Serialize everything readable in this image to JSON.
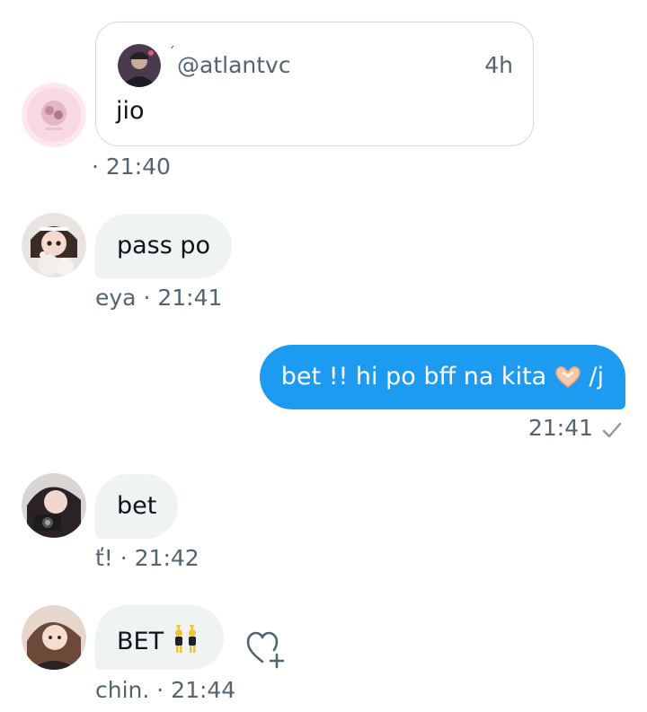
{
  "colors": {
    "background": "#ffffff",
    "incoming_bubble": "#eff3f4",
    "outgoing_bubble": "#1d9bf0",
    "muted_text": "#536471",
    "card_border": "#cfd9de"
  },
  "messages": [
    {
      "id": "m1",
      "direction": "incoming",
      "type": "quoted-post",
      "avatar_icon": "pink-circle-avatar",
      "quote": {
        "avatar_icon": "profile-avatar",
        "name_mark": "ˊ",
        "handle": "@atlantvc",
        "time": "4h",
        "text": "jio"
      },
      "meta": "· 21:40"
    },
    {
      "id": "m2",
      "direction": "incoming",
      "avatar_icon": "girl-with-bear-avatar",
      "text": "pass po",
      "meta": "eya · 21:41"
    },
    {
      "id": "m3",
      "direction": "outgoing",
      "text": "bet !! hi po bff na kita",
      "emoji_icon": "heart-hands-emoji",
      "suffix": "/j",
      "meta": "21:41",
      "status_icon": "check-icon"
    },
    {
      "id": "m4",
      "direction": "incoming",
      "avatar_icon": "girl-with-camera-avatar",
      "text": "bet",
      "meta": "ť! · 21:42"
    },
    {
      "id": "m5",
      "direction": "incoming",
      "avatar_icon": "girl-portrait-avatar",
      "text": "BET",
      "emoji_icon": "dancing-bunnies-emoji",
      "meta": "chin. · 21:44",
      "action_icon": "add-reaction-heart-icon"
    }
  ]
}
